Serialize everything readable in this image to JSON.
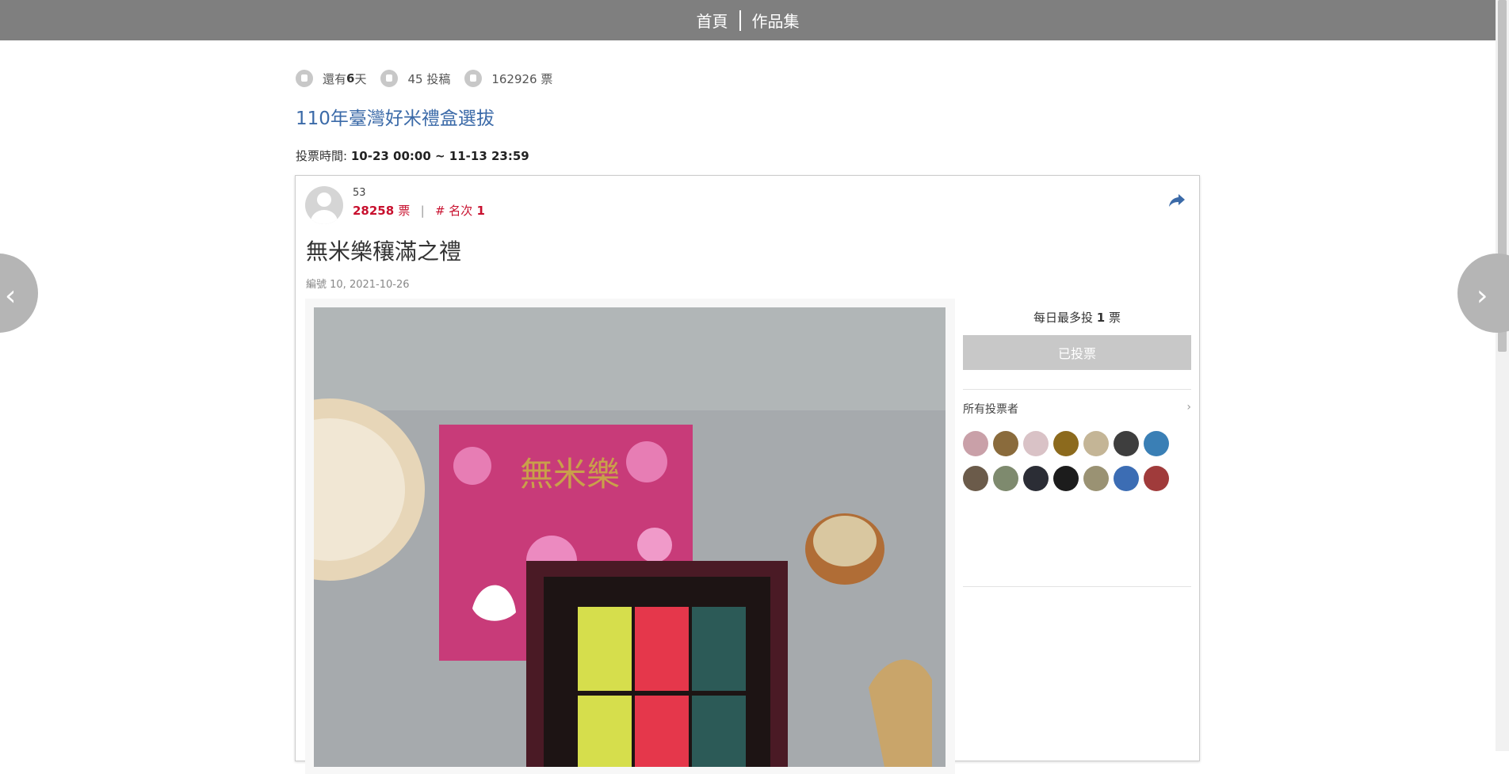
{
  "topnav": {
    "home": "首頁",
    "works": "作品集"
  },
  "stats": {
    "days_prefix": "還有",
    "days_value": "6",
    "days_suffix": "天",
    "posts": "45 投稿",
    "votes": "162926 票"
  },
  "event": {
    "title": "110年臺灣好米禮盒選拔",
    "vote_time_label": "投票時間:",
    "vote_time_value": "10-23 00:00 ~ 11-13 23:59"
  },
  "entry": {
    "author": "53",
    "vote_count": "28258",
    "vote_unit": "票",
    "rank_label": "# 名次",
    "rank_value": "1",
    "title": "無米樂穰滿之禮",
    "meta": "編號 10, 2021-10-26",
    "image_alt": "rice-gift-box-photo"
  },
  "sidebar": {
    "daily_prefix": "每日最多投",
    "daily_value": "1",
    "daily_suffix": "票",
    "voted_button": "已投票",
    "voters_title": "所有投票者",
    "voter_colors": [
      "#c9a0a8",
      "#8a6b3c",
      "#d9c2c6",
      "#8c6a1d",
      "#c4b596",
      "#3e3e3e",
      "#3a7fb5",
      "#6b5b4a",
      "#7e8a6e",
      "#2b2d35",
      "#1c1c1c",
      "#9a9273",
      "#3c6db4",
      "#a03b3b"
    ]
  },
  "colors": {
    "accent": "#3b6aa8",
    "rank": "#c8102e",
    "topbar": "#7f7f7f"
  }
}
